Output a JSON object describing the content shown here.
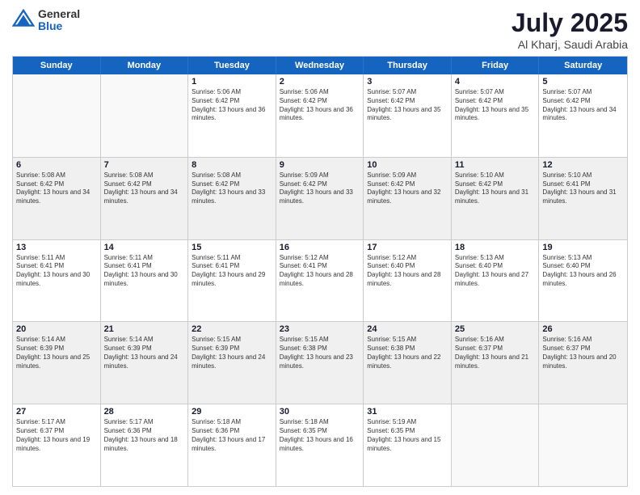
{
  "logo": {
    "general": "General",
    "blue": "Blue"
  },
  "header": {
    "month": "July 2025",
    "location": "Al Kharj, Saudi Arabia"
  },
  "weekdays": [
    "Sunday",
    "Monday",
    "Tuesday",
    "Wednesday",
    "Thursday",
    "Friday",
    "Saturday"
  ],
  "rows": [
    {
      "alt": false,
      "cells": [
        {
          "day": "",
          "info": ""
        },
        {
          "day": "",
          "info": ""
        },
        {
          "day": "1",
          "info": "Sunrise: 5:06 AM\nSunset: 6:42 PM\nDaylight: 13 hours and 36 minutes."
        },
        {
          "day": "2",
          "info": "Sunrise: 5:06 AM\nSunset: 6:42 PM\nDaylight: 13 hours and 36 minutes."
        },
        {
          "day": "3",
          "info": "Sunrise: 5:07 AM\nSunset: 6:42 PM\nDaylight: 13 hours and 35 minutes."
        },
        {
          "day": "4",
          "info": "Sunrise: 5:07 AM\nSunset: 6:42 PM\nDaylight: 13 hours and 35 minutes."
        },
        {
          "day": "5",
          "info": "Sunrise: 5:07 AM\nSunset: 6:42 PM\nDaylight: 13 hours and 34 minutes."
        }
      ]
    },
    {
      "alt": true,
      "cells": [
        {
          "day": "6",
          "info": "Sunrise: 5:08 AM\nSunset: 6:42 PM\nDaylight: 13 hours and 34 minutes."
        },
        {
          "day": "7",
          "info": "Sunrise: 5:08 AM\nSunset: 6:42 PM\nDaylight: 13 hours and 34 minutes."
        },
        {
          "day": "8",
          "info": "Sunrise: 5:08 AM\nSunset: 6:42 PM\nDaylight: 13 hours and 33 minutes."
        },
        {
          "day": "9",
          "info": "Sunrise: 5:09 AM\nSunset: 6:42 PM\nDaylight: 13 hours and 33 minutes."
        },
        {
          "day": "10",
          "info": "Sunrise: 5:09 AM\nSunset: 6:42 PM\nDaylight: 13 hours and 32 minutes."
        },
        {
          "day": "11",
          "info": "Sunrise: 5:10 AM\nSunset: 6:42 PM\nDaylight: 13 hours and 31 minutes."
        },
        {
          "day": "12",
          "info": "Sunrise: 5:10 AM\nSunset: 6:41 PM\nDaylight: 13 hours and 31 minutes."
        }
      ]
    },
    {
      "alt": false,
      "cells": [
        {
          "day": "13",
          "info": "Sunrise: 5:11 AM\nSunset: 6:41 PM\nDaylight: 13 hours and 30 minutes."
        },
        {
          "day": "14",
          "info": "Sunrise: 5:11 AM\nSunset: 6:41 PM\nDaylight: 13 hours and 30 minutes."
        },
        {
          "day": "15",
          "info": "Sunrise: 5:11 AM\nSunset: 6:41 PM\nDaylight: 13 hours and 29 minutes."
        },
        {
          "day": "16",
          "info": "Sunrise: 5:12 AM\nSunset: 6:41 PM\nDaylight: 13 hours and 28 minutes."
        },
        {
          "day": "17",
          "info": "Sunrise: 5:12 AM\nSunset: 6:40 PM\nDaylight: 13 hours and 28 minutes."
        },
        {
          "day": "18",
          "info": "Sunrise: 5:13 AM\nSunset: 6:40 PM\nDaylight: 13 hours and 27 minutes."
        },
        {
          "day": "19",
          "info": "Sunrise: 5:13 AM\nSunset: 6:40 PM\nDaylight: 13 hours and 26 minutes."
        }
      ]
    },
    {
      "alt": true,
      "cells": [
        {
          "day": "20",
          "info": "Sunrise: 5:14 AM\nSunset: 6:39 PM\nDaylight: 13 hours and 25 minutes."
        },
        {
          "day": "21",
          "info": "Sunrise: 5:14 AM\nSunset: 6:39 PM\nDaylight: 13 hours and 24 minutes."
        },
        {
          "day": "22",
          "info": "Sunrise: 5:15 AM\nSunset: 6:39 PM\nDaylight: 13 hours and 24 minutes."
        },
        {
          "day": "23",
          "info": "Sunrise: 5:15 AM\nSunset: 6:38 PM\nDaylight: 13 hours and 23 minutes."
        },
        {
          "day": "24",
          "info": "Sunrise: 5:15 AM\nSunset: 6:38 PM\nDaylight: 13 hours and 22 minutes."
        },
        {
          "day": "25",
          "info": "Sunrise: 5:16 AM\nSunset: 6:37 PM\nDaylight: 13 hours and 21 minutes."
        },
        {
          "day": "26",
          "info": "Sunrise: 5:16 AM\nSunset: 6:37 PM\nDaylight: 13 hours and 20 minutes."
        }
      ]
    },
    {
      "alt": false,
      "cells": [
        {
          "day": "27",
          "info": "Sunrise: 5:17 AM\nSunset: 6:37 PM\nDaylight: 13 hours and 19 minutes."
        },
        {
          "day": "28",
          "info": "Sunrise: 5:17 AM\nSunset: 6:36 PM\nDaylight: 13 hours and 18 minutes."
        },
        {
          "day": "29",
          "info": "Sunrise: 5:18 AM\nSunset: 6:36 PM\nDaylight: 13 hours and 17 minutes."
        },
        {
          "day": "30",
          "info": "Sunrise: 5:18 AM\nSunset: 6:35 PM\nDaylight: 13 hours and 16 minutes."
        },
        {
          "day": "31",
          "info": "Sunrise: 5:19 AM\nSunset: 6:35 PM\nDaylight: 13 hours and 15 minutes."
        },
        {
          "day": "",
          "info": ""
        },
        {
          "day": "",
          "info": ""
        }
      ]
    }
  ]
}
